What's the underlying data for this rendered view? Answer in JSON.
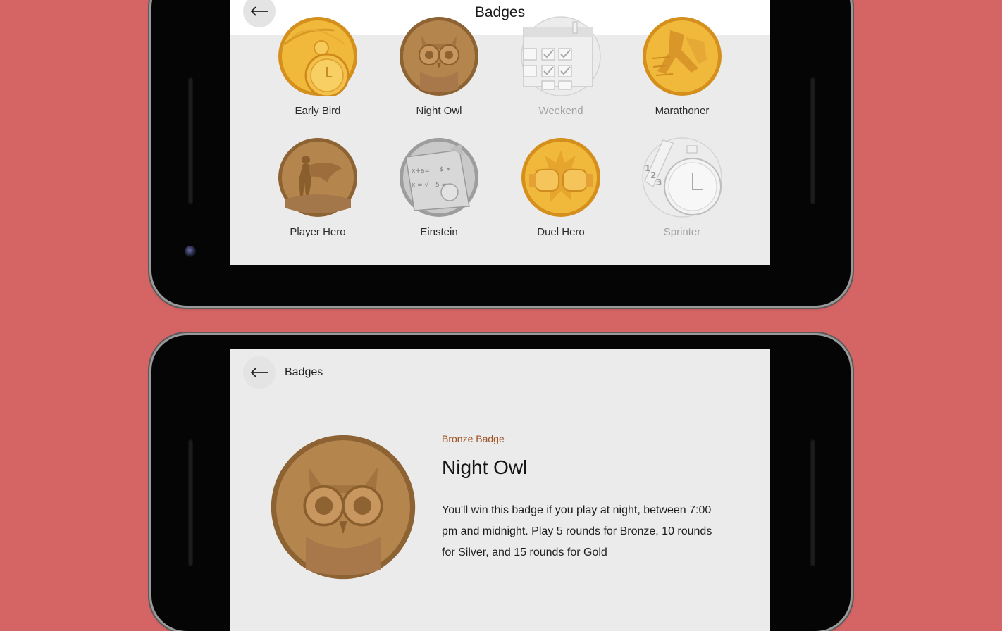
{
  "badges_screen": {
    "title": "Badges",
    "badges": [
      {
        "label": "Early Bird",
        "tier": "gold",
        "icon": "early-bird-clock-icon"
      },
      {
        "label": "Night Owl",
        "tier": "bronze",
        "icon": "night-owl-icon"
      },
      {
        "label": "Weekend",
        "tier": "locked",
        "icon": "weekend-calendar-icon"
      },
      {
        "label": "Marathoner",
        "tier": "gold",
        "icon": "marathoner-icon"
      },
      {
        "label": "Player Hero",
        "tier": "bronze",
        "icon": "player-hero-icon"
      },
      {
        "label": "Einstein",
        "tier": "silver",
        "icon": "einstein-formula-icon"
      },
      {
        "label": "Duel Hero",
        "tier": "gold",
        "icon": "duel-hero-gloves-icon"
      },
      {
        "label": "Sprinter",
        "tier": "locked",
        "icon": "sprinter-stopwatch-icon"
      }
    ]
  },
  "detail_screen": {
    "appbar_label": "Badges",
    "tier_label": "Bronze Badge",
    "badge_name": "Night Owl",
    "description": "You'll win this badge if you play at night, between 7:00 pm and midnight. Play 5 rounds for Bronze, 10 rounds for Silver, and 15 rounds for Gold"
  },
  "colors": {
    "background": "#d56464",
    "gold": "#e8aa2c",
    "bronze": "#a97a45",
    "silver": "#b7b7b7",
    "tier_label": "#9c4f1f"
  }
}
